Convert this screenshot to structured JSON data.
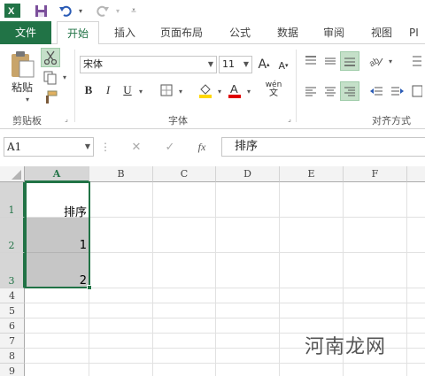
{
  "qab": {
    "excel_icon": "excel-logo-icon",
    "save_icon": "save-icon",
    "undo_icon": "undo-icon",
    "redo_icon": "redo-icon",
    "customize_icon": "customize-qab-icon"
  },
  "tabs": [
    {
      "label": "文件"
    },
    {
      "label": "开始"
    },
    {
      "label": "插入"
    },
    {
      "label": "页面布局"
    },
    {
      "label": "公式"
    },
    {
      "label": "数据"
    },
    {
      "label": "审阅"
    },
    {
      "label": "视图"
    },
    {
      "label": "PI"
    }
  ],
  "ribbon": {
    "clipboard": {
      "paste_label": "粘贴",
      "group_label": "剪贴板"
    },
    "font": {
      "font_name": "宋体",
      "font_size": "11",
      "bold": "B",
      "italic": "I",
      "underline": "U",
      "phonetic": "wén",
      "group_label": "字体"
    },
    "alignment": {
      "group_label": "对齐方式"
    }
  },
  "formula_bar": {
    "name_box": "A1",
    "cancel": "✕",
    "enter": "✓",
    "fx": "fx",
    "content": "排序"
  },
  "grid": {
    "columns": [
      "A",
      "B",
      "C",
      "D",
      "E",
      "F"
    ],
    "rows": [
      "1",
      "2",
      "3",
      "4",
      "5",
      "6",
      "7",
      "8",
      "9"
    ],
    "cells": {
      "A1": "排序",
      "A2": "1",
      "A3": "2"
    }
  },
  "watermark": "河南龙网",
  "colors": {
    "accent": "#217346",
    "selection": "#c6c6c6"
  }
}
